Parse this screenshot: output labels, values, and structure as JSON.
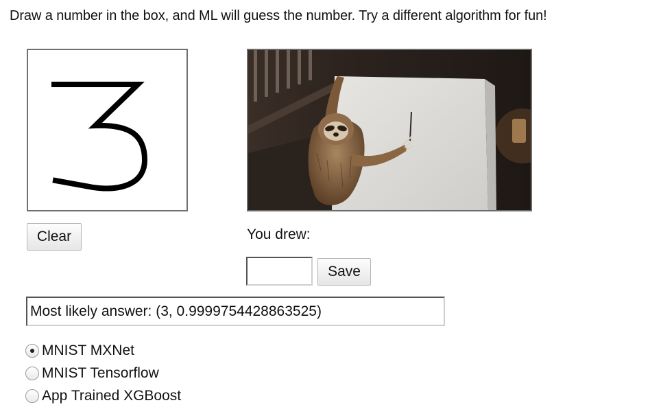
{
  "instructions": "Draw a number in the box, and ML will guess the number. Try a different algorithm for fun!",
  "canvas": {
    "drawn_digit": "3",
    "ink_color": "#000000",
    "background": "#ffffff"
  },
  "clear_label": "Clear",
  "result": {
    "you_drew_label": "You drew:",
    "input_value": "",
    "save_label": "Save"
  },
  "answer_text": "Most likely answer: (3, 0.9999754428863525)",
  "algorithms": [
    {
      "label": "MNIST MXNet",
      "selected": true
    },
    {
      "label": "MNIST Tensorflow",
      "selected": false
    },
    {
      "label": "App Trained XGBoost",
      "selected": false
    }
  ]
}
